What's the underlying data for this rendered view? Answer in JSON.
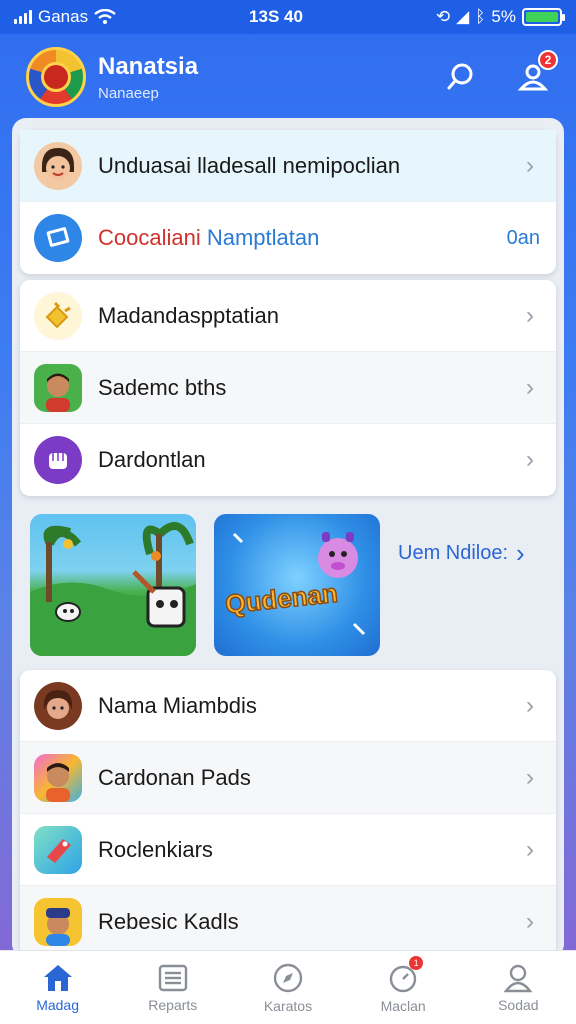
{
  "status_bar": {
    "carrier": "Ganas",
    "time": "13S 40",
    "battery": "5%"
  },
  "header": {
    "title": "Nanatsia",
    "subtitle": "Nanaeep",
    "notification_count": "2"
  },
  "group1": [
    {
      "label": "Unduasai lladesall nemipoclian",
      "icon": "avatar-woman-icon",
      "highlight": true
    },
    {
      "label_red": "Coocaliani",
      "label_blue": "Namptlatan",
      "value": "0an",
      "icon": "book-icon"
    }
  ],
  "group2": [
    {
      "label": "Madandaspptatian",
      "icon": "plug-icon"
    },
    {
      "label": "Sademc bths",
      "icon": "avatar-man-icon"
    },
    {
      "label": "Dardontlan",
      "icon": "fist-icon"
    }
  ],
  "games": {
    "tile1_name": "jungle-game-tile",
    "tile2_text": "Qudenan",
    "see_more": "Uem Ndiloe:"
  },
  "group3": [
    {
      "label": "Nama Miambdis",
      "icon": "avatar-woman-dark-icon"
    },
    {
      "label": "Cardonan Pads",
      "icon": "avatar-boy-icon"
    },
    {
      "label": "Roclenkiars",
      "icon": "tag-icon"
    },
    {
      "label": "Rebesic Kadls",
      "icon": "avatar-hat-icon"
    }
  ],
  "bottom_nav": [
    {
      "label": "Madag",
      "icon": "home-icon",
      "active": true
    },
    {
      "label": "Reparts",
      "icon": "list-icon"
    },
    {
      "label": "Karatos",
      "icon": "compass-icon"
    },
    {
      "label": "Maclan",
      "icon": "timer-icon",
      "badge": "1"
    },
    {
      "label": "Sodad",
      "icon": "user-icon"
    }
  ],
  "colors": {
    "accent": "#2a66d6",
    "header_bg": "#2f6df0",
    "badge": "#e33333"
  }
}
